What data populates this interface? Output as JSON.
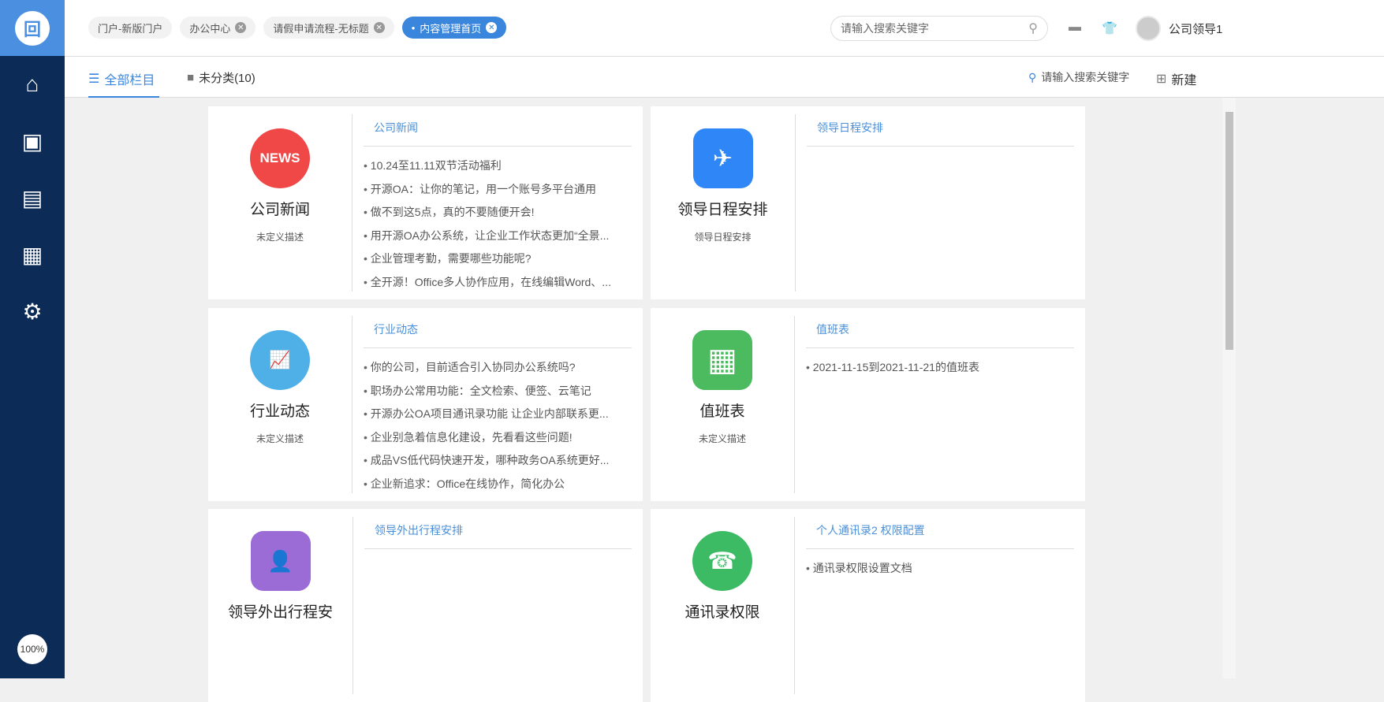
{
  "sidebar": {
    "zoom": "100%"
  },
  "header": {
    "tabs": [
      {
        "label": "门户-新版门户",
        "closable": false
      },
      {
        "label": "办公中心",
        "closable": true
      },
      {
        "label": "请假申请流程-无标题",
        "closable": true
      },
      {
        "label": "内容管理首页",
        "closable": true,
        "active": true
      }
    ],
    "search_placeholder": "请输入搜索关键字",
    "user": "公司领导1"
  },
  "subbar": {
    "all": "全部栏目",
    "uncategorized": "未分类(10)",
    "search_placeholder": "请输入搜索关键字",
    "new": "新建"
  },
  "cards": [
    {
      "title": "公司新闻",
      "desc": "未定义描述",
      "panel_title": "公司新闻",
      "icon_text": "NEWS",
      "color": "#f04747",
      "items": [
        "10.24至11.11双节活动福利",
        "开源OA：让你的笔记，用一个账号多平台通用",
        "做不到这5点，真的不要随便开会!",
        "用开源OA办公系统，让企业工作状态更加“全景...",
        "企业管理考勤，需要哪些功能呢?",
        "全开源！Office多人协作应用，在线编辑Word、..."
      ]
    },
    {
      "title": "领导日程安排",
      "desc": "领导日程安排",
      "panel_title": "领导日程安排",
      "color": "#2f86f6",
      "items": []
    },
    {
      "title": "行业动态",
      "desc": "未定义描述",
      "panel_title": "行业动态",
      "color": "#4fb0e8",
      "items": [
        "你的公司，目前适合引入协同办公系统吗?",
        "职场办公常用功能：全文检索、便签、云笔记",
        "开源办公OA项目通讯录功能 让企业内部联系更...",
        "企业别急着信息化建设，先看看这些问题!",
        "成品VS低代码快速开发，哪种政务OA系统更好...",
        "企业新追求：Office在线协作，简化办公"
      ]
    },
    {
      "title": "值班表",
      "desc": "未定义描述",
      "panel_title": "值班表",
      "color": "#4cba5f",
      "items": [
        "2021-11-15到2021-11-21的值班表"
      ]
    },
    {
      "title": "领导外出行程安",
      "desc": "",
      "panel_title": "领导外出行程安排",
      "color": "#9b6bd6",
      "items": []
    },
    {
      "title": "通讯录权限",
      "desc": "",
      "panel_title": "个人通讯录2   权限配置",
      "color": "#3dbb64",
      "items": [
        "通讯录权限设置文档"
      ]
    }
  ]
}
